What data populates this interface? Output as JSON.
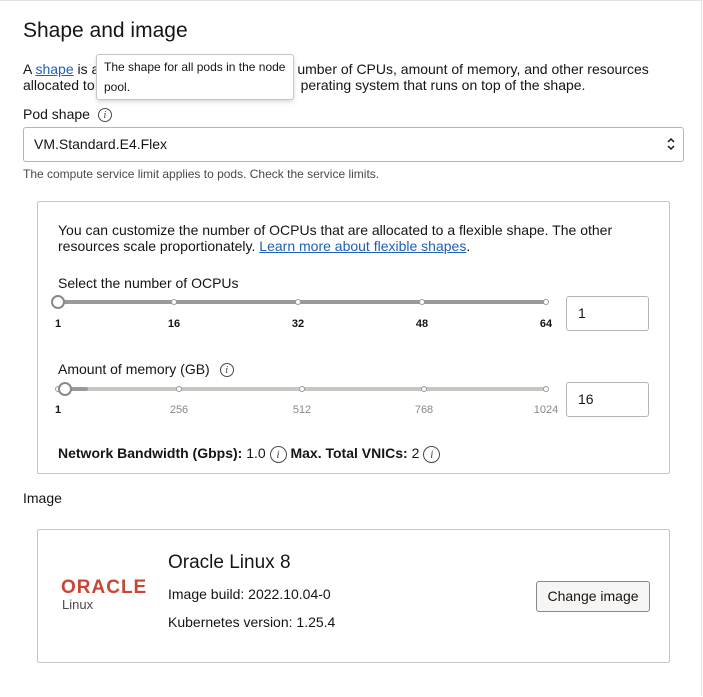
{
  "section": {
    "title": "Shape and image",
    "desc_prefix": "A ",
    "desc_link": "shape",
    "desc_rest_line1": " is a",
    "desc_line1_tail": "umber of CPUs, amount of memory, and other resources",
    "desc_line2_head": "allocated to",
    "desc_line2_tail": "perating system that runs on top of the shape.",
    "tooltip": "The shape for all pods in the node pool."
  },
  "pod_shape": {
    "label": "Pod shape",
    "info_icon": "i",
    "value": "VM.Standard.E4.Flex",
    "hint": "The compute service limit applies to pods. Check the service limits."
  },
  "flex": {
    "text": "You can customize the number of OCPUs that are allocated to a flexible shape. The other resources scale proportionately.",
    "link": "Learn more about flexible shapes",
    "link_suffix": ".",
    "ocpu": {
      "label": "Select the number of OCPUs",
      "ticks": [
        "1",
        "16",
        "32",
        "48",
        "64"
      ],
      "value": "1",
      "min": 1,
      "max": 64
    },
    "memory": {
      "label": "Amount of memory (GB)",
      "ticks": [
        "1",
        "256",
        "512",
        "768",
        "1024"
      ],
      "value": "16",
      "min": 1,
      "max": 1024
    },
    "bandwidth_label": "Network Bandwidth (Gbps):",
    "bandwidth_value": "1.0",
    "vnics_label": "Max. Total VNICs:",
    "vnics_value": "2"
  },
  "image": {
    "label": "Image",
    "logo_text": "ORACLE",
    "logo_sub": "Linux",
    "name": "Oracle Linux 8",
    "build_label": "Image build: 2022.10.04-0",
    "k8s_label": "Kubernetes version: 1.25.4",
    "change_button": "Change image"
  },
  "colors": {
    "link": "#1f5fb8",
    "oracle_red": "#c74634"
  }
}
